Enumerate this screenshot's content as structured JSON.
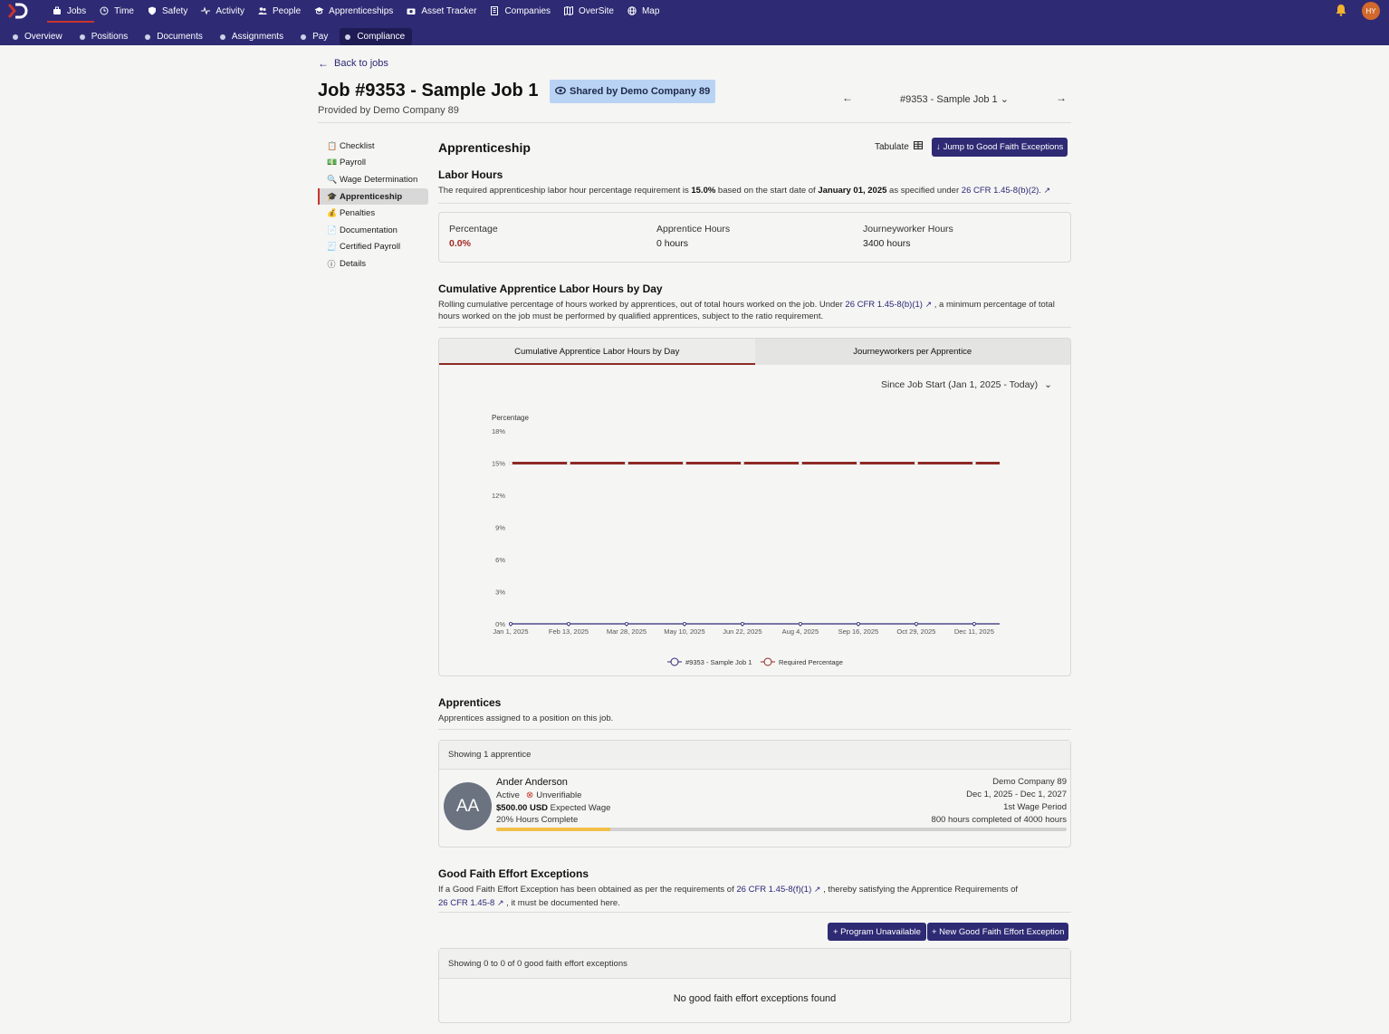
{
  "topnav": {
    "items": [
      {
        "label": "Jobs",
        "icon": "briefcase-icon"
      },
      {
        "label": "Time",
        "icon": "clock-icon"
      },
      {
        "label": "Safety",
        "icon": "shield-icon"
      },
      {
        "label": "Activity",
        "icon": "pulse-icon"
      },
      {
        "label": "People",
        "icon": "people-icon"
      },
      {
        "label": "Apprenticeships",
        "icon": "graduation-cap-icon"
      },
      {
        "label": "Asset Tracker",
        "icon": "camera-icon"
      },
      {
        "label": "Companies",
        "icon": "building-icon"
      },
      {
        "label": "OverSite",
        "icon": "map-book-icon"
      },
      {
        "label": "Map",
        "icon": "globe-icon"
      }
    ],
    "avatar_initials": "HY"
  },
  "subnav": {
    "items": [
      "Overview",
      "Positions",
      "Documents",
      "Assignments",
      "Pay",
      "Compliance"
    ]
  },
  "header": {
    "back_label": "Back to jobs",
    "title": "Job #9353 - Sample Job 1",
    "shared_badge": "Shared by Demo Company 89",
    "provided_by": "Provided by Demo Company 89",
    "job_selector": "#9353 - Sample Job 1"
  },
  "sidebar": {
    "items": [
      {
        "label": "Checklist",
        "icon": "clipboard-check-icon"
      },
      {
        "label": "Payroll",
        "icon": "money-icon"
      },
      {
        "label": "Wage Determination",
        "icon": "magnifier-icon"
      },
      {
        "label": "Apprenticeship",
        "icon": "graduation-cap-icon"
      },
      {
        "label": "Penalties",
        "icon": "money-bag-icon"
      },
      {
        "label": "Documentation",
        "icon": "file-icon"
      },
      {
        "label": "Certified Payroll",
        "icon": "file-dollar-icon"
      },
      {
        "label": "Details",
        "icon": "info-icon"
      }
    ]
  },
  "apprenticeship": {
    "heading": "Apprenticeship",
    "tabulate_label": "Tabulate",
    "jump_button": "Jump to Good Faith Exceptions"
  },
  "labor": {
    "heading": "Labor Hours",
    "desc_pre": "The required apprenticeship labor hour percentage requirement is ",
    "desc_pct": "15.0%",
    "desc_mid": " based on the start date of ",
    "desc_date": "January 01, 2025",
    "desc_post": " as specified under ",
    "desc_link": "26 CFR 1.45-8(b)(2).",
    "stats": {
      "percentage_label": "Percentage",
      "percentage_value": "0.0%",
      "apprentice_label": "Apprentice Hours",
      "apprentice_value": "0 hours",
      "journey_label": "Journeyworker Hours",
      "journey_value": "3400 hours"
    }
  },
  "cumulative": {
    "heading": "Cumulative Apprentice Labor Hours by Day",
    "desc_pre": "Rolling cumulative percentage of hours worked by apprentices, out of total hours worked on the job. Under ",
    "desc_link": "26 CFR 1.45-8(b)(1)",
    "desc_post": " , a minimum percentage of total hours worked on the job must be performed by qualified apprentices, subject to the ratio requirement.",
    "tabs": [
      "Cumulative Apprentice Labor Hours by Day",
      "Journeyworkers per Apprentice"
    ],
    "range_label": "Since Job Start (Jan 1, 2025 - Today)"
  },
  "chart_data": {
    "type": "line",
    "ylabel": "Percentage",
    "ylim": [
      0,
      18
    ],
    "yticks": [
      "0%",
      "3%",
      "6%",
      "9%",
      "12%",
      "15%",
      "18%"
    ],
    "x": [
      "Jan 1, 2025",
      "Feb 13, 2025",
      "Mar 28, 2025",
      "May 10, 2025",
      "Jun 22, 2025",
      "Aug 4, 2025",
      "Sep 16, 2025",
      "Oct 29, 2025",
      "Dec 11, 2025"
    ],
    "series": [
      {
        "name": "#9353 - Sample Job 1",
        "color": "#2e2a74",
        "values": [
          0,
          0,
          0,
          0,
          0,
          0,
          0,
          0,
          0
        ]
      },
      {
        "name": "Required Percentage",
        "color": "#8e2a25",
        "values": [
          15,
          15,
          15,
          15,
          15,
          15,
          15,
          15,
          15
        ]
      }
    ],
    "grid": false,
    "legend": "bottom-center"
  },
  "apprentices": {
    "heading": "Apprentices",
    "desc": "Apprentices assigned to a position on this job.",
    "showing": "Showing 1 apprentice",
    "person": {
      "initials": "AA",
      "name": "Ander Anderson",
      "status": "Active",
      "verification": "Unverifiable",
      "wage_amount": "$500.00 USD",
      "wage_label": " Expected Wage",
      "hours_pct_label": "20% Hours Complete",
      "progress": 0.2,
      "company": "Demo Company 89",
      "period_dates": "Dec 1, 2025 - Dec 1, 2027",
      "wage_period": "1st Wage Period",
      "hours_summary": "800 hours completed of 4000 hours"
    }
  },
  "gfe": {
    "heading": "Good Faith Effort Exceptions",
    "desc_pre": "If a Good Faith Effort Exception has been obtained as per the requirements of ",
    "desc_link1": "26 CFR 1.45-8(f)(1)",
    "desc_mid": " , thereby satisfying the Apprentice Requirements of",
    "desc_link2": "26 CFR 1.45-8",
    "desc_post": " , it must be documented here.",
    "btn_program": "+ Program Unavailable",
    "btn_new": "+ New Good Faith Effort Exception",
    "showing": "Showing 0 to 0 of 0 good faith effort exceptions",
    "empty": "No good faith effort exceptions found"
  }
}
